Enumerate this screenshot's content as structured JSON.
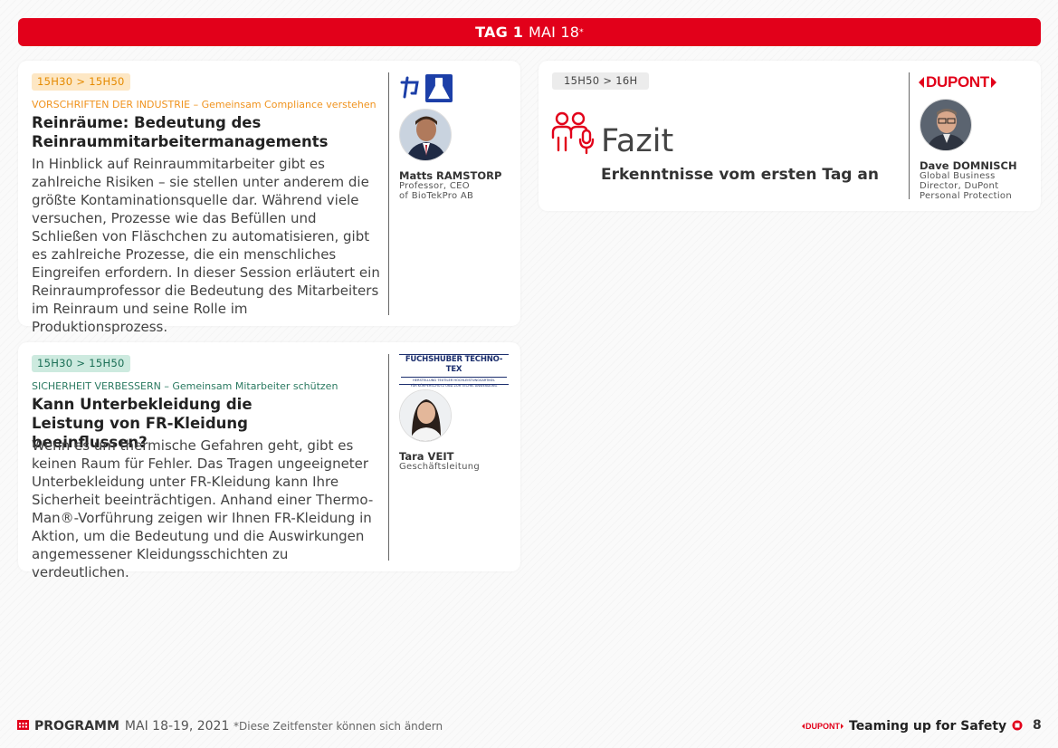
{
  "banner": {
    "day": "TAG 1",
    "date": "MAI 18",
    "mark": "*"
  },
  "sessions": [
    {
      "time": "15H30 > 15H50",
      "topic": "VORSCHRIFTEN DER INDUSTRIE – Gemeinsam Compliance verstehen",
      "title": "Reinräume: Bedeutung des Reinraummitarbeitermanagements",
      "text": "In Hinblick auf Reinraummitarbeiter gibt es zahlreiche Risiken – sie stellen unter anderem die größte Kontaminationsquelle dar. Während viele versuchen, Prozesse wie das Befüllen und Schließen von Fläschchen zu automatisieren, gibt es zahlreiche Prozesse, die ein menschliches Eingreifen erfordern. In dieser Session erläutert ein Reinraumprofessor die Bedeutung des Mitarbeiters im Reinraum und seine Rolle im Produktionsprozess.",
      "speaker": {
        "name": "Matts RAMSTORP",
        "role1": "Professor, CEO",
        "role2": "of BioTekPro AB"
      },
      "logo": "biotekpro-logo",
      "accent": "#f0931e"
    },
    {
      "time": "15H30 > 15H50",
      "topic": "SICHERHEIT VERBESSERN – Gemeinsam Mitarbeiter schützen",
      "title": "Kann Unterbekleidung die Leistung von FR-Kleidung beeinflussen?",
      "text": "Wenn es um thermische Gefahren geht, gibt es keinen Raum für Fehler. Das Tragen ungeeigneter Unterbekleidung unter FR-Kleidung kann Ihre Sicherheit beeinträchtigen. Anhand einer Thermo-Man®-Vorführung zeigen wir Ihnen FR-Kleidung in Aktion, um die Bedeutung und die Auswirkungen angemessener Kleidungsschichten zu verdeutlichen.",
      "speaker": {
        "name": "Tara VEIT",
        "role1": "Geschäftsleitung"
      },
      "logo_text": "FUCHSHUBER TECHNO-TEX",
      "logo_sub1": "HERSTELLUNG TEXTILER HOCHLEISTUNGSARTIKEL",
      "logo_sub2": "FÜR KÖRPERSCHUTZ UND ZUR TECHN. ANWENDUNG",
      "accent": "#2b7a61"
    }
  ],
  "fazit": {
    "time": "15H50 > 16H",
    "title": "Fazit",
    "subtitle": "Erkenntnisse vom ersten Tag an",
    "speaker": {
      "name": "Dave DOMNISCH",
      "role1": "Global Business",
      "role2": "Director, DuPont",
      "role3": "Personal Protection"
    },
    "logo_text": "DUPONT"
  },
  "footer": {
    "program": "PROGRAMM",
    "dates": "MAI 18-19, 2021",
    "note": "*Diese Zeitfenster können sich ändern",
    "brand": "DUPONT",
    "tagline": "Teaming up for Safety",
    "page": "8"
  },
  "colors": {
    "brand_red": "#e2001a"
  }
}
